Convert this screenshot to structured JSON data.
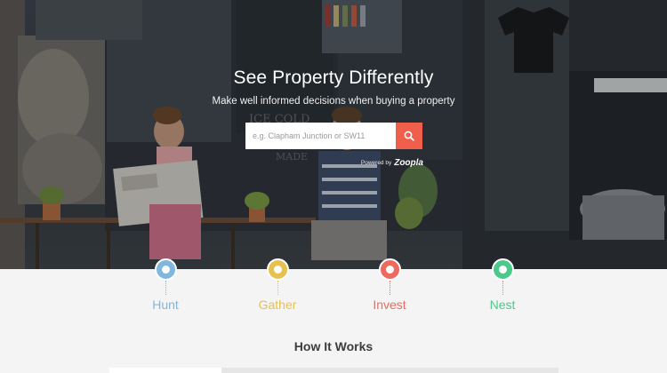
{
  "hero": {
    "title": "See Property Differently",
    "subtitle": "Make well informed decisions when buying a property",
    "search": {
      "placeholder": "e.g. Clapham Junction or SW11",
      "value": "",
      "button_icon": "search-icon"
    },
    "powered_by": {
      "text": "Powered by",
      "brand": "Zoopla"
    },
    "background_image": "cafe-storefront-photo"
  },
  "steps": [
    {
      "label": "Hunt",
      "color": "#7fb8dc"
    },
    {
      "label": "Gather",
      "color": "#e6c14d"
    },
    {
      "label": "Invest",
      "color": "#ee6a5c"
    },
    {
      "label": "Nest",
      "color": "#4cc98a"
    }
  ],
  "how_it_works": {
    "title": "How It Works"
  },
  "colors": {
    "accent": "#ef5f4c",
    "page_background": "#f4f4f4"
  }
}
